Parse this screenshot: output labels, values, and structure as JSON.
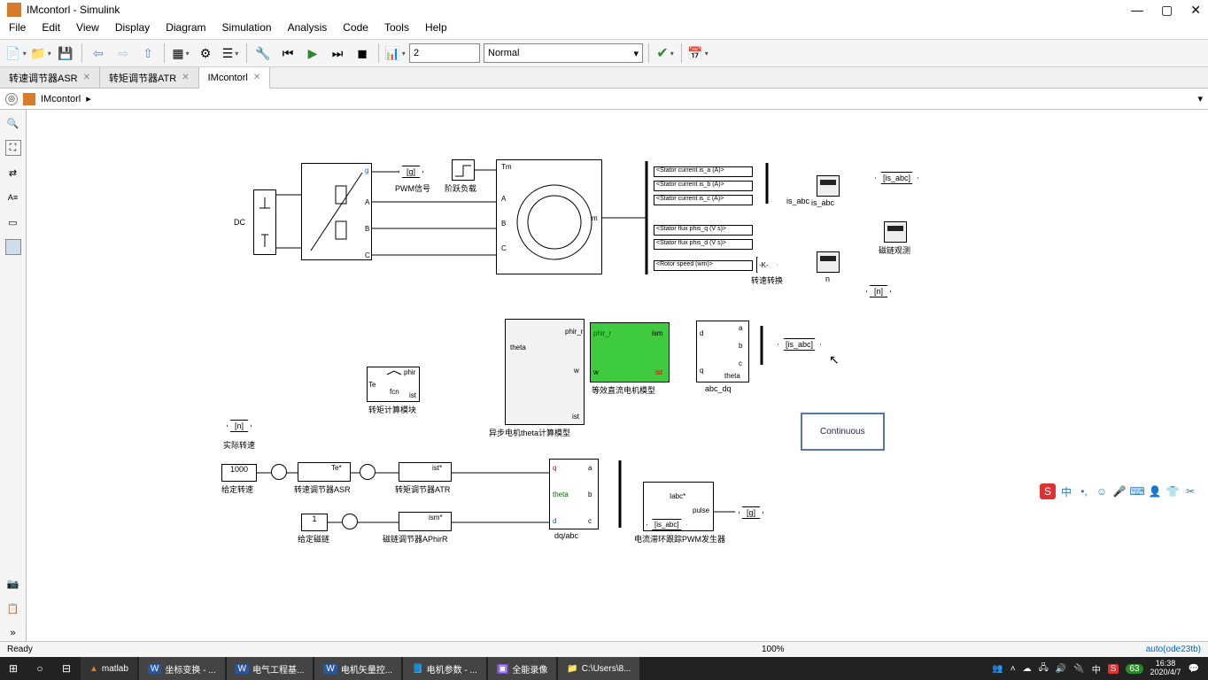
{
  "window": {
    "title": "IMcontorl - Simulink"
  },
  "menu": [
    "File",
    "Edit",
    "View",
    "Display",
    "Diagram",
    "Simulation",
    "Analysis",
    "Code",
    "Tools",
    "Help"
  ],
  "toolbar": {
    "step": "2",
    "mode": "Normal"
  },
  "tabs": [
    {
      "label": "转速调节器ASR",
      "active": false
    },
    {
      "label": "转矩调节器ATR",
      "active": false
    },
    {
      "label": "IMcontorl",
      "active": true
    }
  ],
  "breadcrumb": {
    "model": "IMcontorl"
  },
  "blocks": {
    "dc_label": "DC",
    "pwm_signal": "PWM信号",
    "step_load": "阶跃负载",
    "tag_g": "[g]",
    "tag_n": "[n]",
    "tag_is_abc": "[is_abc]",
    "stator_a": "<Stator current is_a (A)>",
    "stator_b": "<Stator current is_b (A)>",
    "stator_c": "<Stator current is_c (A)>",
    "flux_q": "<Stator flux phis_q (V s)>",
    "flux_d": "<Stator flux phis_d (V s)>",
    "rotor_w": "<Rotor speed (wm)>",
    "speed_conv": "转速转换",
    "is_abc_scope": "is_abc",
    "flux_scope": "磁链观测",
    "n_scope": "n",
    "gain_k": "-K-",
    "abc_dq": "abc_dq",
    "equiv_dc_motor": "等效直流电机模型",
    "async_theta": "异步电机theta计算模型",
    "torque_calc": "转矩计算模块",
    "continuous": "Continuous",
    "actual_speed": "实际转速",
    "given_speed": "给定转速",
    "given_flux": "给定磁链",
    "const_1000": "1000",
    "const_1": "1",
    "asr": "转速调节器ASR",
    "atr": "转矩调节器ATR",
    "aphirr": "磁链调节器APhirR",
    "dq_abc": "dq/abc",
    "pwm_gen": "电流滞环跟踪PWM发生器",
    "port_tm": "Tm",
    "port_a": "A",
    "port_b": "B",
    "port_c": "C",
    "port_g": "g",
    "port_m": "m",
    "port_phir_r": "phir_r",
    "port_theta": "theta",
    "port_w": "w",
    "port_ist": "ist",
    "port_ism": "ism",
    "port_phir": "phir",
    "port_te": "Te",
    "port_te_star": "Te*",
    "port_ist_star": "ist*",
    "port_ism_star": "ism*",
    "port_q": "q",
    "port_d": "d",
    "port_a2": "a",
    "port_b2": "b",
    "port_c2": "c",
    "port_iabc_star": "Iabc*",
    "port_iabc": "Iabc",
    "port_pulse": "pulse",
    "fcn": "fcn"
  },
  "status": {
    "ready": "Ready",
    "zoom": "100%",
    "solver": "auto(ode23tb)"
  },
  "taskbar": {
    "items": [
      "matlab",
      "坐标变换 - ...",
      "电气工程基...",
      "电机矢量控...",
      "电机参数 - ...",
      "全能录像",
      "C:\\Users\\8..."
    ],
    "time": "16:38",
    "date": "2020/4/7",
    "badge": "63"
  }
}
